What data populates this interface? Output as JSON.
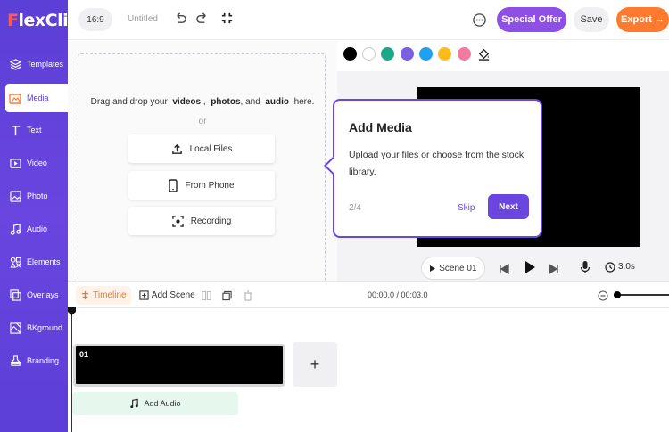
{
  "app": {
    "logo_initial": "F",
    "logo_text": "lexClip",
    "project_title": "Untitled"
  },
  "sidebar": {
    "items": [
      {
        "label": "Templates",
        "icon": "layers-icon"
      },
      {
        "label": "Media",
        "icon": "media-icon",
        "active": true
      },
      {
        "label": "Text",
        "icon": "text-icon"
      },
      {
        "label": "Video",
        "icon": "video-icon"
      },
      {
        "label": "Photo",
        "icon": "photo-icon"
      },
      {
        "label": "Audio",
        "icon": "audio-icon"
      },
      {
        "label": "Elements",
        "icon": "elements-icon"
      },
      {
        "label": "Overlays",
        "icon": "overlays-icon"
      },
      {
        "label": "BKground",
        "icon": "background-icon"
      },
      {
        "label": "Branding",
        "icon": "branding-icon"
      }
    ]
  },
  "toolbar": {
    "ratio": "16:9",
    "special_offer": "Special Offer",
    "save": "Save",
    "export": "Export →"
  },
  "media": {
    "drop_prefix": "Drag and drop your",
    "drop_videos": "videos",
    "drop_sep1": ",",
    "drop_photos": "photos",
    "drop_sep2": ", and",
    "drop_audio": "audio",
    "drop_suffix": "here.",
    "or": "or",
    "local_files": "Local Files",
    "from_phone": "From Phone",
    "recording": "Recording"
  },
  "colors": {
    "swatches": [
      "#000000",
      "#ffffff",
      "#1aa889",
      "#7a5fe0",
      "#1ea1f2",
      "#ffbb1c",
      "#f07aa0"
    ],
    "accent": "#6a45e0",
    "export": "#ff7a2f",
    "special_offer": "#8e4fe6"
  },
  "player": {
    "scene_label": "Scene 01",
    "duration": "3.0s"
  },
  "popover": {
    "title": "Add Media",
    "body": "Upload your files or choose from the stock library.",
    "step": "2/4",
    "skip": "Skip",
    "next": "Next"
  },
  "timeline": {
    "tab_label": "Timeline",
    "add_scene": "Add Scene",
    "time": "00:00.0 / 00:03.0",
    "clip_label": "01",
    "add_scene_plus": "+",
    "add_audio": "Add Audio"
  }
}
